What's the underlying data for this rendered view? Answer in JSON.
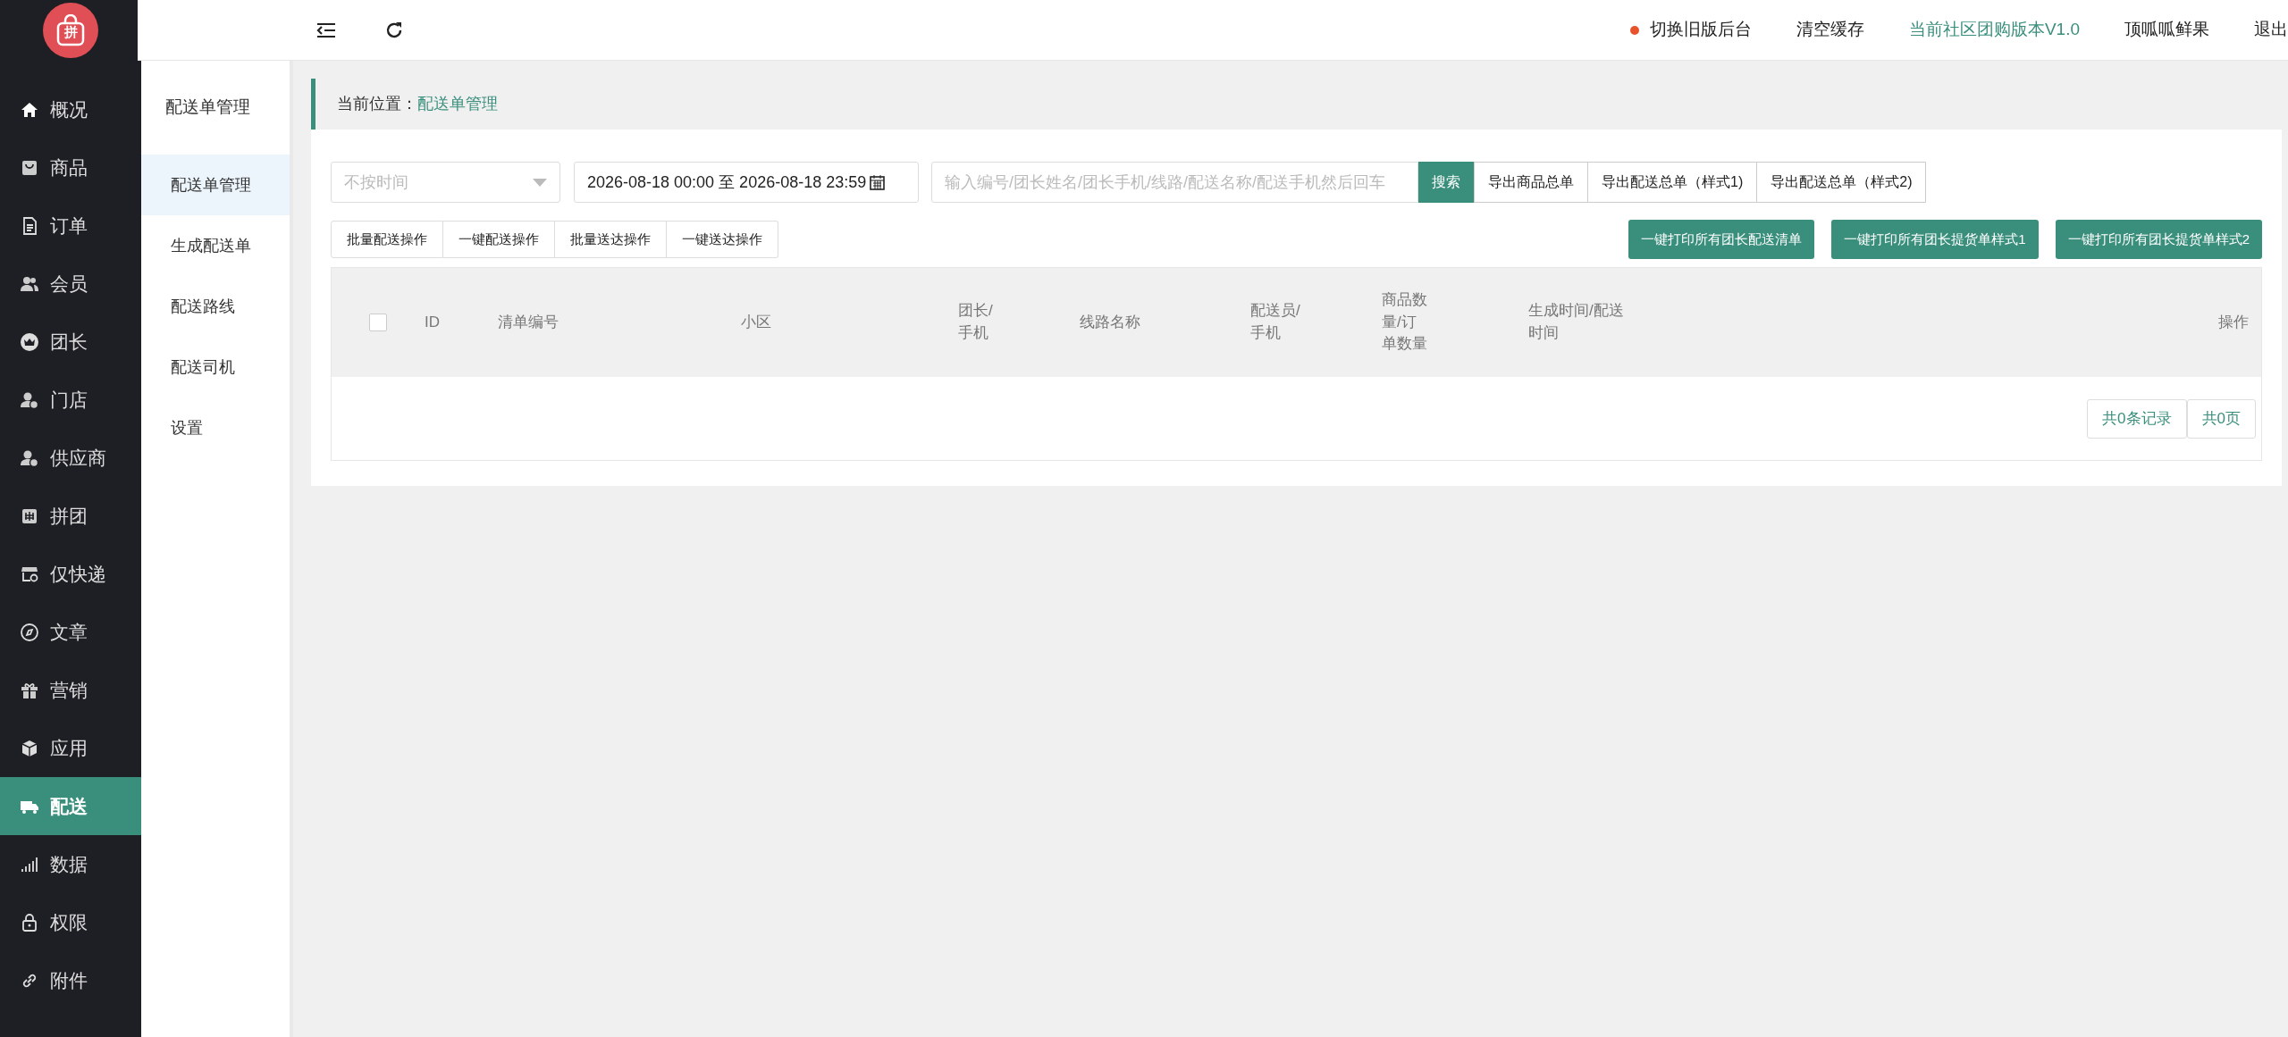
{
  "logo": {
    "text": "拼"
  },
  "nav": [
    {
      "label": "概况",
      "selected": false
    },
    {
      "label": "商品",
      "selected": false
    },
    {
      "label": "订单",
      "selected": false
    },
    {
      "label": "会员",
      "selected": false
    },
    {
      "label": "团长",
      "selected": false
    },
    {
      "label": "门店",
      "selected": false
    },
    {
      "label": "供应商",
      "selected": false
    },
    {
      "label": "拼团",
      "selected": false
    },
    {
      "label": "仅快递",
      "selected": false
    },
    {
      "label": "文章",
      "selected": false
    },
    {
      "label": "营销",
      "selected": false
    },
    {
      "label": "应用",
      "selected": false
    },
    {
      "label": "配送",
      "selected": true
    },
    {
      "label": "数据",
      "selected": false
    },
    {
      "label": "权限",
      "selected": false
    },
    {
      "label": "附件",
      "selected": false
    }
  ],
  "subnav": {
    "title": "配送单管理",
    "items": [
      {
        "label": "配送单管理",
        "selected": true
      },
      {
        "label": "生成配送单",
        "selected": false
      },
      {
        "label": "配送路线",
        "selected": false
      },
      {
        "label": "配送司机",
        "selected": false
      },
      {
        "label": "设置",
        "selected": false
      }
    ]
  },
  "topbar": [
    {
      "label": "切换旧版后台",
      "kind": "dot"
    },
    {
      "label": "清空缓存",
      "kind": "plain"
    },
    {
      "label": "当前社区团购版本V1.0",
      "kind": "accent"
    },
    {
      "label": "顶呱呱鲜果",
      "kind": "plain"
    },
    {
      "label": "退出",
      "kind": "plain"
    }
  ],
  "breadcrumb": {
    "prefix": "当前位置：",
    "current": "配送单管理"
  },
  "filters": {
    "time_select": {
      "placeholder": "不按时间"
    },
    "date_range": {
      "value": "2026-08-18 00:00 至 2026-08-18 23:59"
    },
    "search": {
      "placeholder": "输入编号/团长姓名/团长手机/线路/配送名称/配送手机然后回车"
    },
    "search_button": "搜索",
    "export_buttons": [
      "导出商品总单",
      "导出配送总单（样式1)",
      "导出配送总单（样式2)"
    ]
  },
  "batch_buttons": [
    "批量配送操作",
    "一键配送操作",
    "批量送达操作",
    "一键送达操作"
  ],
  "print_buttons": [
    "一键打印所有团长配送清单",
    "一键打印所有团长提货单样式1",
    "一键打印所有团长提货单样式2"
  ],
  "table": {
    "select_all": {
      "checked": false
    },
    "columns": [
      "ID",
      "清单编号",
      "小区",
      "团长/手机",
      "线路名称",
      "配送员/手机",
      "商品数量/订单数量",
      "生成时间/配送时间",
      "操作"
    ]
  },
  "pager": [
    "共0条记录",
    "共0页"
  ]
}
